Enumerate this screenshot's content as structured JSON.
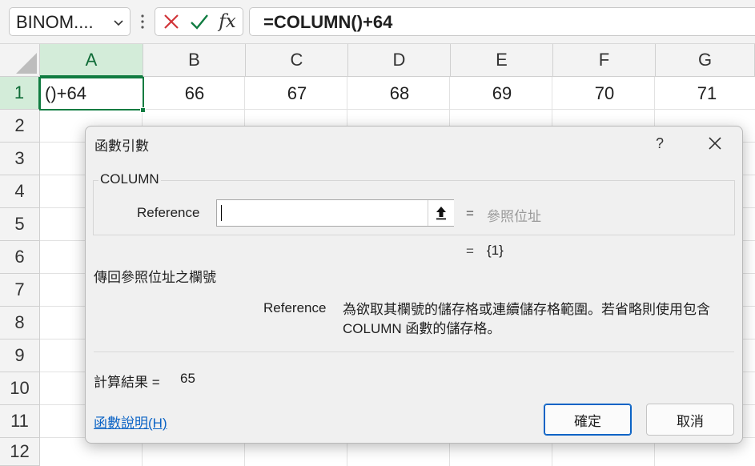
{
  "formula_bar": {
    "name_box": "BINOM....",
    "cancel_icon": "x-icon",
    "enter_icon": "check-icon",
    "fx_label": "fx",
    "formula": "=COLUMN()+64"
  },
  "grid": {
    "columns": [
      "A",
      "B",
      "C",
      "D",
      "E",
      "F",
      "G"
    ],
    "rows": [
      "1",
      "2",
      "3",
      "4",
      "5",
      "6",
      "7",
      "8",
      "9",
      "10",
      "11",
      "12"
    ],
    "row1": [
      "()+64",
      "66",
      "67",
      "68",
      "69",
      "70",
      "71"
    ]
  },
  "dialog": {
    "title": "函數引數",
    "help_button": "?",
    "function_name": "COLUMN",
    "argument_label": "Reference",
    "argument_value": "",
    "argument_eq": "=",
    "argument_hint": "參照位址",
    "result_eq": "=",
    "result_value": "{1}",
    "function_description": "傳回參照位址之欄號",
    "arg_help_name": "Reference",
    "arg_help_text": "為欲取其欄號的儲存格或連續儲存格範圍。若省略則使用包含 COLUMN 函數的儲存格。",
    "calc_label": "計算結果 =",
    "calc_value": "65",
    "help_link": "函數說明(H)",
    "ok_button": "確定",
    "cancel_button": "取消"
  },
  "colors": {
    "accent_green": "#107c41",
    "link_blue": "#0b63c5",
    "cancel_red": "#d13438",
    "enter_green": "#107c41"
  }
}
